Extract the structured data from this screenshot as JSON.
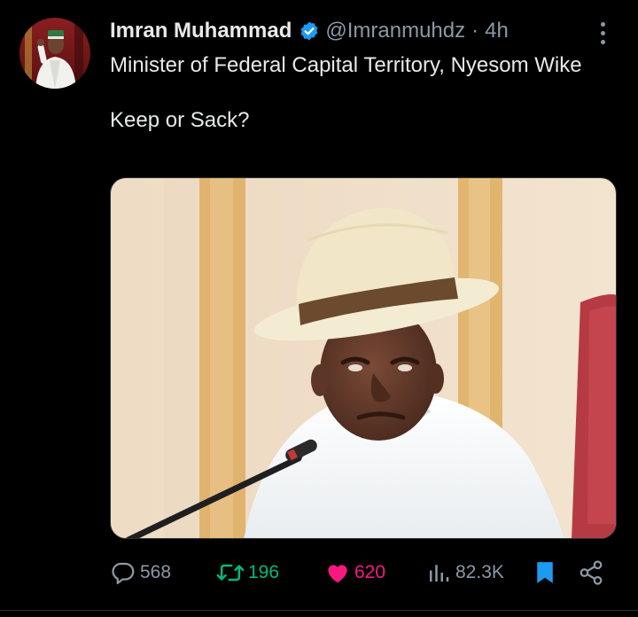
{
  "tweet": {
    "author_name": "Imran Muhammad",
    "handle": "@Imranmuhdz",
    "separator": "·",
    "time": "4h",
    "text_line1": "Minister of Federal Capital Territory, Nyesom Wike",
    "text_line2": "Keep or Sack?"
  },
  "actions": {
    "replies": "568",
    "retweets": "196",
    "likes": "620",
    "views": "82.3K"
  },
  "colors": {
    "background": "#000000",
    "text": "#e7e9ea",
    "muted": "#8b98a5",
    "verified": "#1d9bf0",
    "retweet": "#00ba7c",
    "like": "#f91880"
  },
  "icons": [
    "verified-badge-icon",
    "more-icon",
    "reply-icon",
    "retweet-icon",
    "like-icon",
    "views-icon",
    "bookmark-icon",
    "share-icon"
  ]
}
